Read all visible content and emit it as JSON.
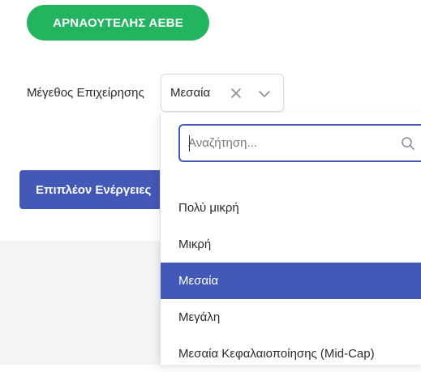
{
  "company": {
    "name": "ΑΡΝΑΟΥΤΕΛΗΣ ΑΕΒΕ"
  },
  "field": {
    "label": "Μέγεθος Επιχείρησης",
    "selected_value": "Μεσαία"
  },
  "actions": {
    "more_label": "Επιπλέον Ενέργειες"
  },
  "dropdown": {
    "search_placeholder": "Αναζήτηση...",
    "search_value": "",
    "options": [
      {
        "label": "Πολύ μικρή",
        "selected": false
      },
      {
        "label": "Μικρή",
        "selected": false
      },
      {
        "label": "Μεσαία",
        "selected": true
      },
      {
        "label": "Μεγάλη",
        "selected": false
      },
      {
        "label": "Μεσαία Κεφαλαιοποίησης (Mid-Cap)",
        "selected": false
      }
    ]
  },
  "colors": {
    "company_badge": "#22b45f",
    "accent": "#4458b8",
    "text": "#2b2b2b"
  },
  "icons": {
    "clear": "close-icon",
    "expand": "chevron-down-icon",
    "search": "search-icon"
  }
}
